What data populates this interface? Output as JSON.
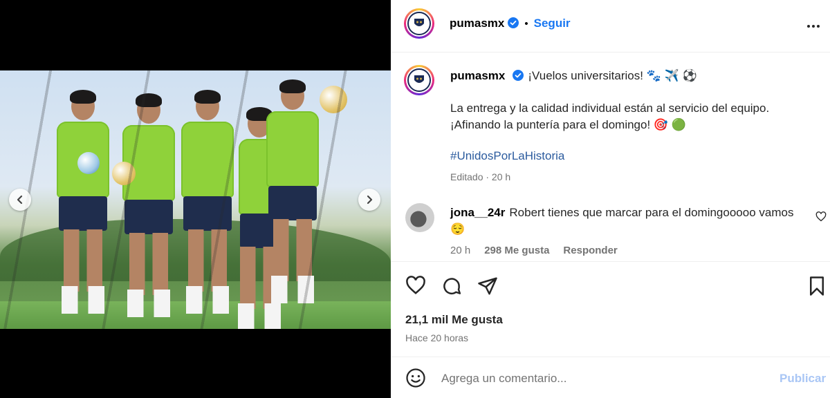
{
  "post": {
    "account": "pumasmx",
    "follow_label": "Seguir",
    "dot": "•",
    "caption_title": "¡Vuelos universitarios! 🐾 ✈️ ⚽",
    "caption_line1": "La entrega y la calidad individual están al servicio del equipo.",
    "caption_line2": "¡Afinando la puntería para el domingo! 🎯 🟢",
    "hashtag": "#UnidosPorLaHistoria",
    "edited": "Editado · 20 h"
  },
  "comment": {
    "username": "jona__24r",
    "text": "Robert tienes que marcar para el domingooooo vamos 😌",
    "time": "20 h",
    "likes": "298 Me gusta",
    "reply": "Responder"
  },
  "stats": {
    "likes": "21,1 mil Me gusta",
    "ago": "Hace 20 horas"
  },
  "composer": {
    "placeholder": "Agrega un comentario...",
    "post_label": "Publicar"
  },
  "icons": {
    "more": "more-icon",
    "verified": "verified-icon",
    "heart": "heart-icon",
    "comment": "comment-icon",
    "share": "share-icon",
    "bookmark": "bookmark-icon",
    "emoji": "emoji-icon",
    "prev": "chevron-left-icon",
    "next": "chevron-right-icon"
  },
  "colors": {
    "link": "#1877f2",
    "hashtag": "#2b5b9e",
    "secondary": "#737373",
    "bib": "#8fd23a"
  }
}
